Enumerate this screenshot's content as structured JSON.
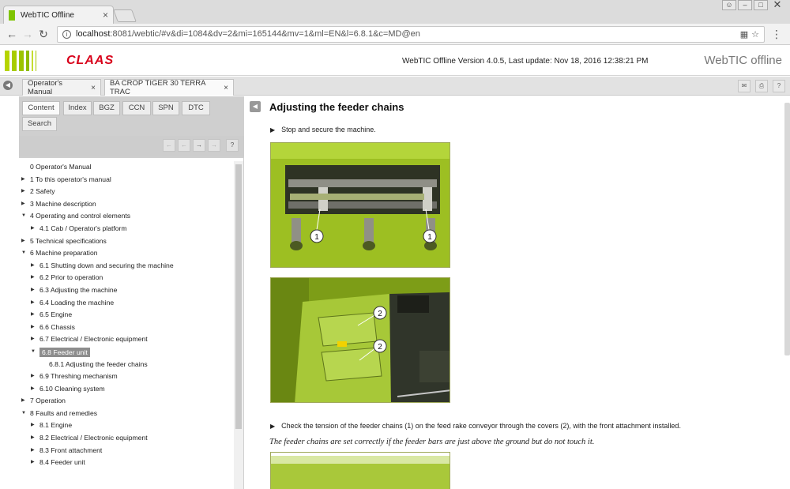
{
  "browser": {
    "tab_title": "WebTIC Offline",
    "tab_close": "×",
    "url_host": "localhost",
    "url_rest": ":8081/webtic/#v&di=1084&dv=2&mi=165144&mv=1&ml=EN&l=6.8.1&c=MD@en"
  },
  "header": {
    "logo_text": "CLAAS",
    "version_text": "WebTIC Offline Version 4.0.5, Last update: Nov 18, 2016 12:38:21 PM",
    "brand": "WebTIC offline"
  },
  "doc_tabs": [
    {
      "label": "Operator's Manual",
      "close": "×"
    },
    {
      "label": "BA CROP TIGER 30 TERRA TRAC",
      "close": "×"
    }
  ],
  "nav_tabs": [
    "Content",
    "Index",
    "BGZ",
    "CCN",
    "SPN",
    "DTC",
    "Search"
  ],
  "nav_icons": [
    "←",
    "←",
    "→",
    "→",
    "?"
  ],
  "tree": [
    {
      "label": "0 Operator's Manual",
      "level": 0,
      "arrow": ""
    },
    {
      "label": "1 To this operator's manual",
      "level": 0,
      "arrow": "▶"
    },
    {
      "label": "2 Safety",
      "level": 0,
      "arrow": "▶"
    },
    {
      "label": "3 Machine description",
      "level": 0,
      "arrow": "▶"
    },
    {
      "label": "4 Operating and control elements",
      "level": 0,
      "arrow": "▼"
    },
    {
      "label": "4.1 Cab / Operator's platform",
      "level": 1,
      "arrow": "▶"
    },
    {
      "label": "5 Technical specifications",
      "level": 0,
      "arrow": "▶"
    },
    {
      "label": "6 Machine preparation",
      "level": 0,
      "arrow": "▼"
    },
    {
      "label": "6.1 Shutting down and securing the machine",
      "level": 1,
      "arrow": "▶"
    },
    {
      "label": "6.2 Prior to operation",
      "level": 1,
      "arrow": "▶"
    },
    {
      "label": "6.3 Adjusting the machine",
      "level": 1,
      "arrow": "▶"
    },
    {
      "label": "6.4 Loading the machine",
      "level": 1,
      "arrow": "▶"
    },
    {
      "label": "6.5 Engine",
      "level": 1,
      "arrow": "▶"
    },
    {
      "label": "6.6 Chassis",
      "level": 1,
      "arrow": "▶"
    },
    {
      "label": "6.7 Electrical / Electronic equipment",
      "level": 1,
      "arrow": "▶"
    },
    {
      "label": "6.8 Feeder unit",
      "level": 1,
      "arrow": "▼",
      "selected": true
    },
    {
      "label": "6.8.1 Adjusting the feeder chains",
      "level": 2,
      "arrow": ""
    },
    {
      "label": "6.9 Threshing mechanism",
      "level": 1,
      "arrow": "▶"
    },
    {
      "label": "6.10 Cleaning system",
      "level": 1,
      "arrow": "▶"
    },
    {
      "label": "7 Operation",
      "level": 0,
      "arrow": "▶"
    },
    {
      "label": "8 Faults and remedies",
      "level": 0,
      "arrow": "▼"
    },
    {
      "label": "8.1 Engine",
      "level": 1,
      "arrow": "▶"
    },
    {
      "label": "8.2 Electrical / Electronic equipment",
      "level": 1,
      "arrow": "▶"
    },
    {
      "label": "8.3 Front attachment",
      "level": 1,
      "arrow": "▶"
    },
    {
      "label": "8.4 Feeder unit",
      "level": 1,
      "arrow": "▶"
    }
  ],
  "content": {
    "title": "Adjusting the feeder chains",
    "step1": "Stop and secure the machine.",
    "step2": "Check the tension of the feeder chains (1) on the feed rake conveyor through the covers (2), with the front attachment installed.",
    "note": "The feeder chains are set correctly if the feeder bars are just above the ground but do not touch it.",
    "callout_1": "1",
    "callout_2": "2"
  },
  "colors": {
    "claas_green": "#a8cc00",
    "claas_red": "#d8001a",
    "selected_item": "#8d8d8d"
  }
}
